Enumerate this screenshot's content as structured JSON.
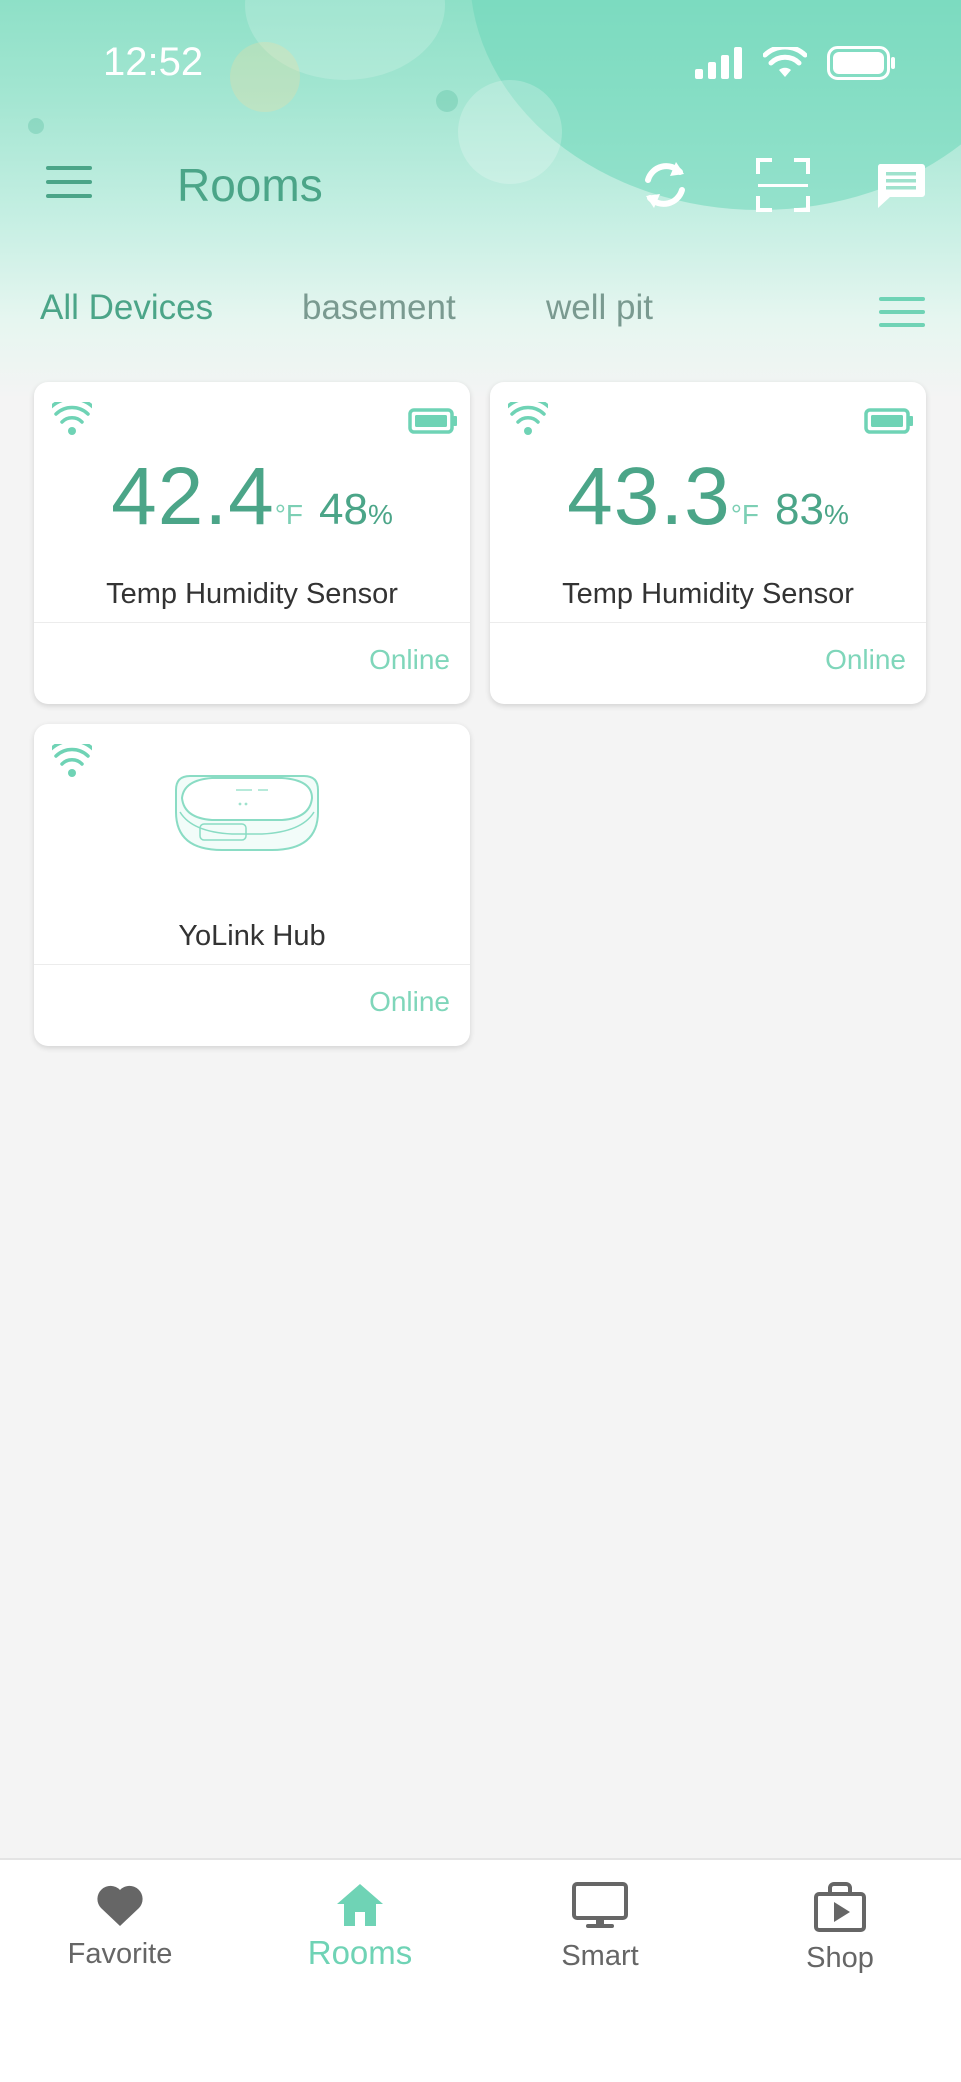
{
  "status_bar": {
    "time": "12:52"
  },
  "header": {
    "title": "Rooms"
  },
  "tabs": [
    {
      "label": "All Devices"
    },
    {
      "label": "basement"
    },
    {
      "label": "well pit"
    }
  ],
  "devices": [
    {
      "name": "Temp Humidity Sensor",
      "temperature": "42.4",
      "temp_unit": "°F",
      "humidity": "48",
      "humidity_unit": "%",
      "status": "Online"
    },
    {
      "name": "Temp Humidity Sensor",
      "temperature": "43.3",
      "temp_unit": "°F",
      "humidity": "83",
      "humidity_unit": "%",
      "status": "Online"
    },
    {
      "name": "YoLink Hub",
      "status": "Online"
    }
  ],
  "bottom_nav": [
    {
      "label": "Favorite",
      "icon": "heart-icon"
    },
    {
      "label": "Rooms",
      "icon": "home-icon",
      "active": true
    },
    {
      "label": "Smart",
      "icon": "monitor-icon"
    },
    {
      "label": "Shop",
      "icon": "shop-bag-icon"
    }
  ],
  "colors": {
    "accent": "#4ba588",
    "accent_light": "#7fd6ba",
    "background": "#f4f4f4"
  }
}
